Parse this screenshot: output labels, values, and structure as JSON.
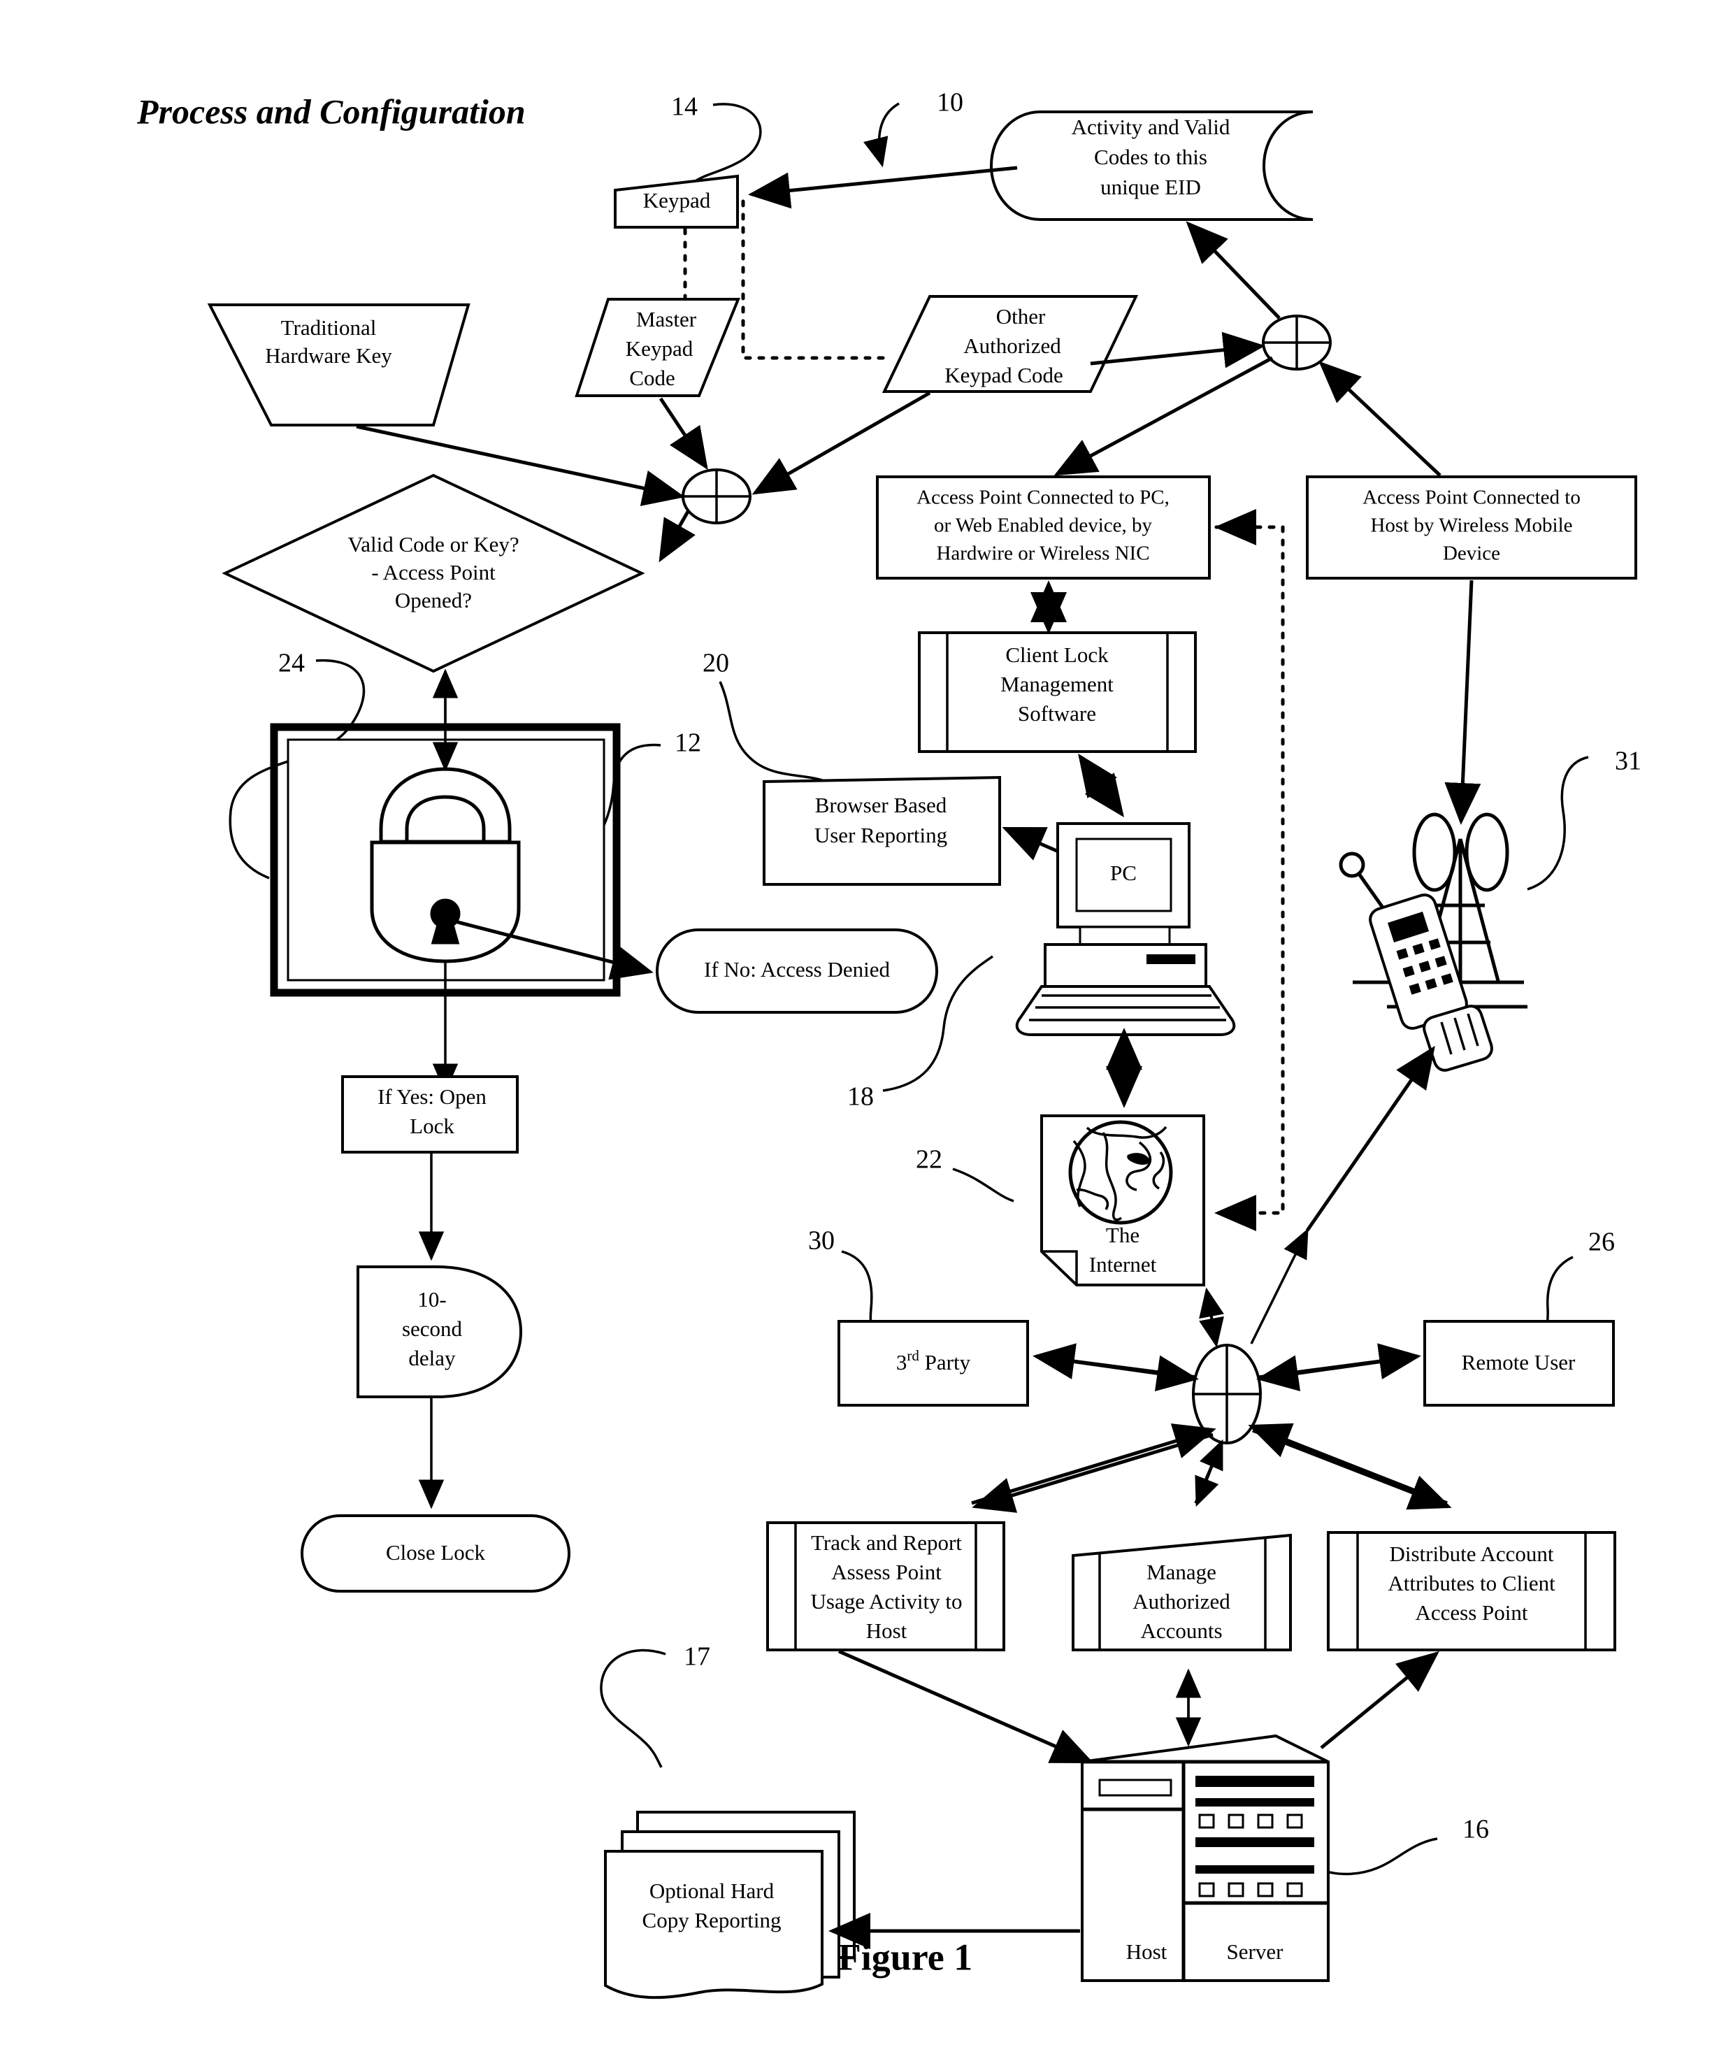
{
  "page": {
    "title": "Process and Configuration",
    "figure_caption": "Figure 1"
  },
  "nodes": {
    "activity_codes": "Activity and Valid\nCodes to this\nunique EID",
    "activity_codes_l1": "Activity and Valid",
    "activity_codes_l2": "Codes to this",
    "activity_codes_l3": "unique EID",
    "keypad": "Keypad",
    "traditional_key_l1": "Traditional",
    "traditional_key_l2": "Hardware Key",
    "master_code_l1": "Master",
    "master_code_l2": "Keypad",
    "master_code_l3": "Code",
    "other_code_l1": "Other",
    "other_code_l2": "Authorized",
    "other_code_l3": "Keypad Code",
    "decision_l1": "Valid Code or Key?",
    "decision_l2": "- Access Point",
    "decision_l3": "Opened?",
    "access_point_pc_l1": "Access Point Connected to PC,",
    "access_point_pc_l2": "or Web Enabled device, by",
    "access_point_pc_l3": "Hardwire or Wireless NIC",
    "access_point_host_l1": "Access Point Connected to",
    "access_point_host_l2": "Host by Wireless Mobile",
    "access_point_host_l3": "Device",
    "client_lock_l1": "Client Lock",
    "client_lock_l2": "Management",
    "client_lock_l3": "Software",
    "browser_report_l1": "Browser Based",
    "browser_report_l2": "User Reporting",
    "pc": "PC",
    "access_denied": "If No: Access Denied",
    "open_lock_l1": "If Yes: Open",
    "open_lock_l2": "Lock",
    "delay_l1": "10-",
    "delay_l2": "second",
    "delay_l3": "delay",
    "close_lock": "Close Lock",
    "internet_l1": "The",
    "internet_l2": "Internet",
    "third_party_main": "3",
    "third_party_sup": "rd",
    "third_party_rest": " Party",
    "remote_user": "Remote User",
    "track_report_l1": "Track and Report",
    "track_report_l2": "Assess Point",
    "track_report_l3": "Usage Activity to",
    "track_report_l4": "Host",
    "manage_accounts_l1": "Manage",
    "manage_accounts_l2": "Authorized",
    "manage_accounts_l3": "Accounts",
    "distribute_l1": "Distribute Account",
    "distribute_l2": "Attributes to Client",
    "distribute_l3": "Access Point",
    "hard_copy_l1": "Optional Hard",
    "hard_copy_l2": "Copy Reporting",
    "host": "Host",
    "server": "Server"
  },
  "ref_numbers": {
    "n10": "10",
    "n12": "12",
    "n14": "14",
    "n16": "16",
    "n17": "17",
    "n18": "18",
    "n20": "20",
    "n22": "22",
    "n24": "24",
    "n26": "26",
    "n30": "30",
    "n31": "31"
  },
  "icons": {
    "padlock": "padlock-icon",
    "globe": "globe-icon",
    "pc": "desktop-computer-icon",
    "mobile": "mobile-phone-icon",
    "tower": "cell-tower-icon",
    "server": "host-server-icon",
    "documents": "stacked-documents-icon"
  },
  "colors": {
    "ink": "#000000",
    "paper": "#ffffff"
  }
}
